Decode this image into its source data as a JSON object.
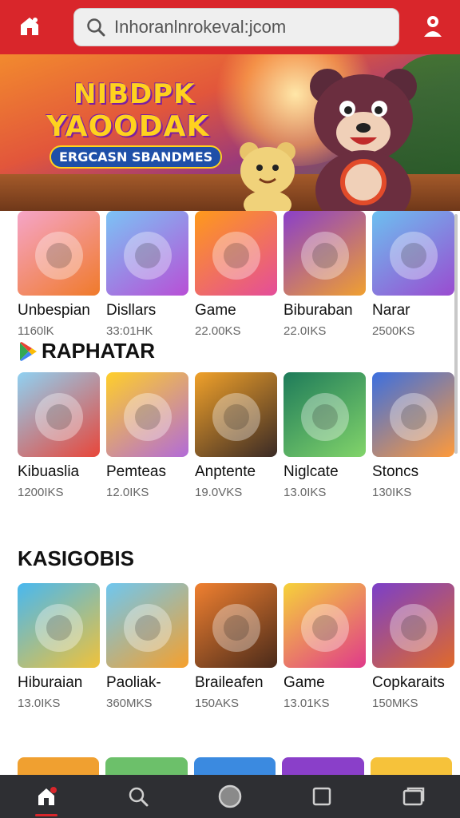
{
  "search": {
    "value": "Inhoranlnrokeval:jcom"
  },
  "banner": {
    "title_line1": "NIBDPK",
    "title_line2": "YAOODAK",
    "subtitle": "ERGCASN SBANDMES"
  },
  "rows": [
    {
      "items": [
        {
          "name": "Unbespian",
          "size": "1160lK",
          "colors": [
            "#f5a5c8",
            "#f07a2a"
          ]
        },
        {
          "name": "Disllars",
          "size": "33:01HK",
          "colors": [
            "#7bc3f5",
            "#b84fd6"
          ]
        },
        {
          "name": "Game",
          "size": "22.00KS",
          "colors": [
            "#ff9a1a",
            "#e44d9a"
          ]
        },
        {
          "name": "Biburaban",
          "size": "22.0IKS",
          "colors": [
            "#8a3fc9",
            "#f0a030"
          ]
        },
        {
          "name": "Narar",
          "size": "2500KS",
          "colors": [
            "#6cc0f0",
            "#9a4bd0"
          ]
        }
      ]
    },
    {
      "items": [
        {
          "name": "Kibuaslia",
          "size": "1200IKS",
          "colors": [
            "#8fd1f2",
            "#e8463a"
          ]
        },
        {
          "name": "Pemteas",
          "size": "12.0IKS",
          "colors": [
            "#ffcf2a",
            "#b26bd8"
          ]
        },
        {
          "name": "Anptente",
          "size": "19.0VKS",
          "colors": [
            "#f0a12a",
            "#3a2a25"
          ]
        },
        {
          "name": "Niglcate",
          "size": "13.0IKS",
          "colors": [
            "#1e7b5a",
            "#82d46a"
          ]
        },
        {
          "name": "Stoncs",
          "size": "130IKS",
          "colors": [
            "#3b6fe0",
            "#ff9a3a"
          ]
        }
      ]
    },
    {
      "items": [
        {
          "name": "Hiburaian",
          "size": "13.0IKS",
          "colors": [
            "#48b8f0",
            "#f0c23a"
          ]
        },
        {
          "name": "Paoliak-",
          "size": "360MKS",
          "colors": [
            "#6ec7f0",
            "#f6a02c"
          ]
        },
        {
          "name": "Braileafen",
          "size": "150AKS",
          "colors": [
            "#f08030",
            "#4a2a1a"
          ]
        },
        {
          "name": "Game",
          "size": "13.01KS",
          "colors": [
            "#f6d23a",
            "#e03a8a"
          ]
        },
        {
          "name": "Copkaraits",
          "size": "150MKS",
          "colors": [
            "#7b3fc9",
            "#e06a2a"
          ]
        }
      ]
    }
  ],
  "sections": {
    "section_2_title": "RAPHATAR",
    "section_3_title": "KASIGOBIS"
  },
  "peek_colors": [
    "#f0a030",
    "#6cc06a",
    "#3b8ae0",
    "#8a3fc9",
    "#f6c23a"
  ],
  "nav": [
    {
      "name": "home",
      "icon": "home-icon"
    },
    {
      "name": "search",
      "icon": "search-icon"
    },
    {
      "name": "circle",
      "icon": "circle-icon"
    },
    {
      "name": "square",
      "icon": "square-icon"
    },
    {
      "name": "tabs",
      "icon": "tabs-icon"
    }
  ],
  "colors": {
    "brand": "#d9262b",
    "nav_bg": "#2e2f33"
  }
}
